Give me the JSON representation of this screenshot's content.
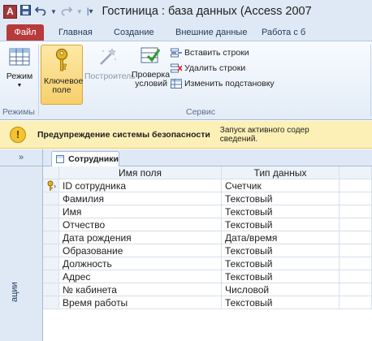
{
  "window": {
    "app_icon_letter": "A",
    "title": "Гостиница : база данных (Access 2007"
  },
  "ribbon_tabs": [
    "Файл",
    "Главная",
    "Создание",
    "Внешние данные",
    "Работа с б"
  ],
  "ribbon": {
    "mode_label": "Режим",
    "mode_group_label": "Режимы",
    "key_field_label": "Ключевое поле",
    "builder_label": "Построитель",
    "check_conditions_label": "Проверка условий",
    "insert_rows_label": "Вставить строки",
    "delete_rows_label": "Удалить строки",
    "change_lookup_label": "Изменить подстановку",
    "service_group_label": "Сервис"
  },
  "security_bar": {
    "title": "Предупреждение системы безопасности",
    "message_line1": "Запуск активного содер",
    "message_line2": "сведений."
  },
  "nav_pane": {
    "toggle": "»",
    "label": "ации"
  },
  "document_tab": {
    "label": "Сотрудники"
  },
  "table_design": {
    "header_name": "Имя поля",
    "header_type": "Тип данных",
    "rows": [
      {
        "name": "ID сотрудника",
        "type": "Счетчик",
        "key": true
      },
      {
        "name": "Фамилия",
        "type": "Текстовый"
      },
      {
        "name": "Имя",
        "type": "Текстовый"
      },
      {
        "name": "Отчество",
        "type": "Текстовый"
      },
      {
        "name": "Дата рождения",
        "type": "Дата/время"
      },
      {
        "name": "Образование",
        "type": "Текстовый"
      },
      {
        "name": "Должность",
        "type": "Текстовый"
      },
      {
        "name": "Адрес",
        "type": "Текстовый"
      },
      {
        "name": "№ кабинета",
        "type": "Числовой"
      },
      {
        "name": "Время работы",
        "type": "Текстовый"
      }
    ]
  },
  "icons": {
    "app": "access-icon",
    "save": "save-icon",
    "undo": "undo-icon",
    "redo": "redo-icon",
    "key": "key-icon",
    "warning": "warning-icon"
  },
  "colors": {
    "file_tab": "#b73b3b",
    "security_bar": "#fdf0b7",
    "ribbon_bg": "#dfe9f5"
  }
}
